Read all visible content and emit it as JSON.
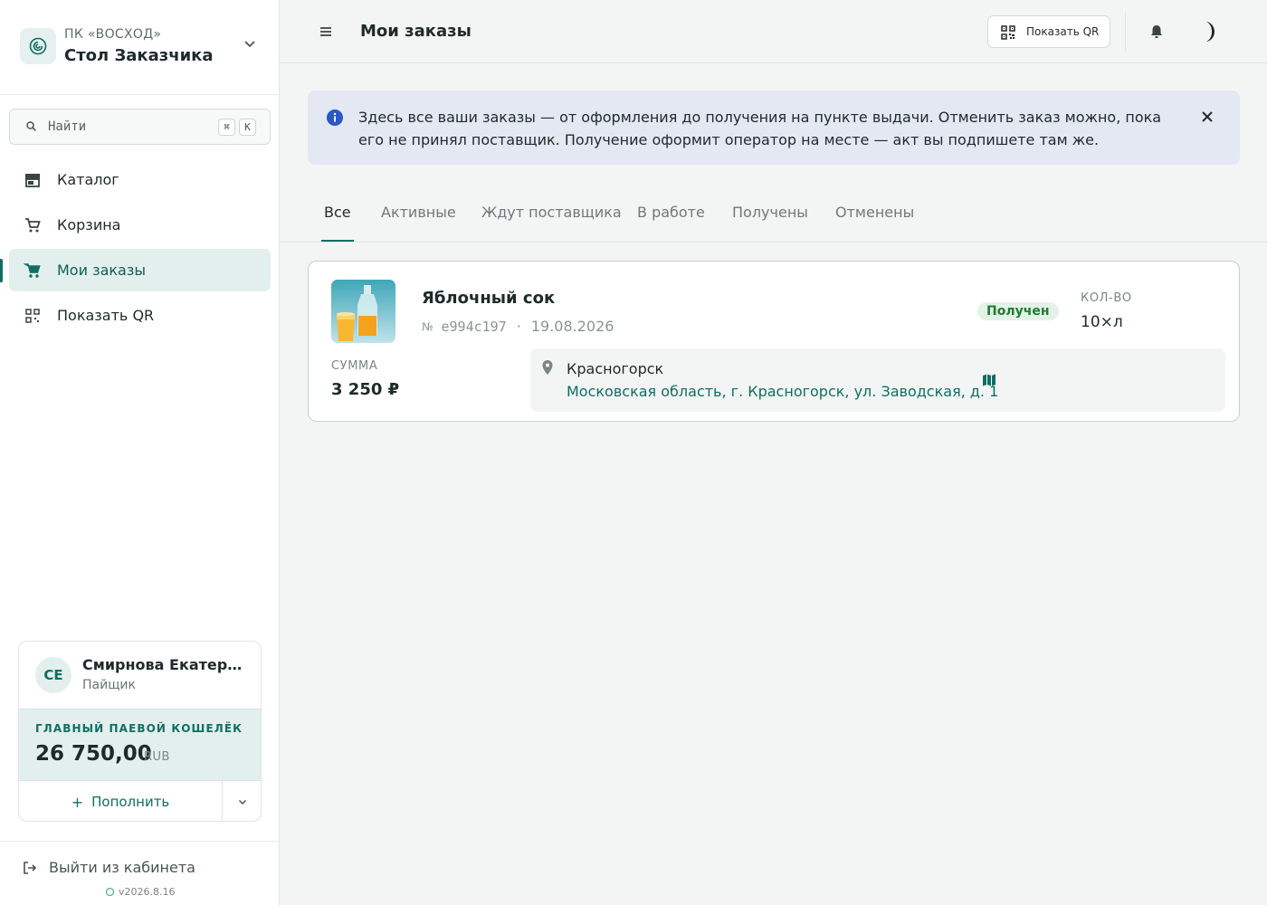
{
  "colors": {
    "accent": "#0f6e62",
    "accent_soft": "#e3efed",
    "banner_bg": "#e3e8f2",
    "info_icon": "#2b57c9",
    "status_received_bg": "#e3f2e6",
    "status_received_text": "#1e7a34"
  },
  "brand": {
    "subtitle": "ПК «ВОСХОД»",
    "title": "Стол Заказчика"
  },
  "search": {
    "placeholder": "Найти",
    "shortcut_mod": "⌘",
    "shortcut_key": "K"
  },
  "sidebar": {
    "items": [
      {
        "label": "Каталог",
        "icon": "store-icon"
      },
      {
        "label": "Корзина",
        "icon": "cart-icon"
      },
      {
        "label": "Мои заказы",
        "icon": "cart-filled-icon",
        "active": true
      },
      {
        "label": "Показать QR",
        "icon": "qr-icon"
      }
    ]
  },
  "user": {
    "initials": "СЕ",
    "name": "Смирнова Екатерина",
    "role": "Пайщик",
    "wallet_label": "ГЛАВНЫЙ ПАЕВОЙ КОШЕЛЁК",
    "wallet_amount": "26 750,00",
    "wallet_currency": "RUB",
    "topup_label": "Пополнить"
  },
  "footer": {
    "logout_label": "Выйти из кабинета",
    "version": "v2026.8.16"
  },
  "header": {
    "title": "Мои заказы",
    "qr_button_label": "Показать QR"
  },
  "banner": {
    "text": "Здесь все ваши заказы — от оформления до получения на пункте выдачи. Отменить заказ можно, пока его не принял поставщик. Получение оформит оператор на месте — акт вы подпишете там же."
  },
  "tabs": [
    {
      "label": "Все",
      "active": true
    },
    {
      "label": "Активные"
    },
    {
      "label": "Ждут поставщика"
    },
    {
      "label": "В работе"
    },
    {
      "label": "Получены"
    },
    {
      "label": "Отменены"
    }
  ],
  "orders": [
    {
      "name": "Яблочный сок",
      "number_sign": "№",
      "id": "e994c197",
      "separator": "·",
      "date": "19.08.2026",
      "status": "Получен",
      "qty_label": "КОЛ-ВО",
      "qty": "10×л",
      "sum_label": "СУММА",
      "sum": "3 250 ₽",
      "pickup_city": "Красногорск",
      "pickup_address": "Московская область, г. Красногорск, ул. Заводская, д. 1"
    }
  ]
}
